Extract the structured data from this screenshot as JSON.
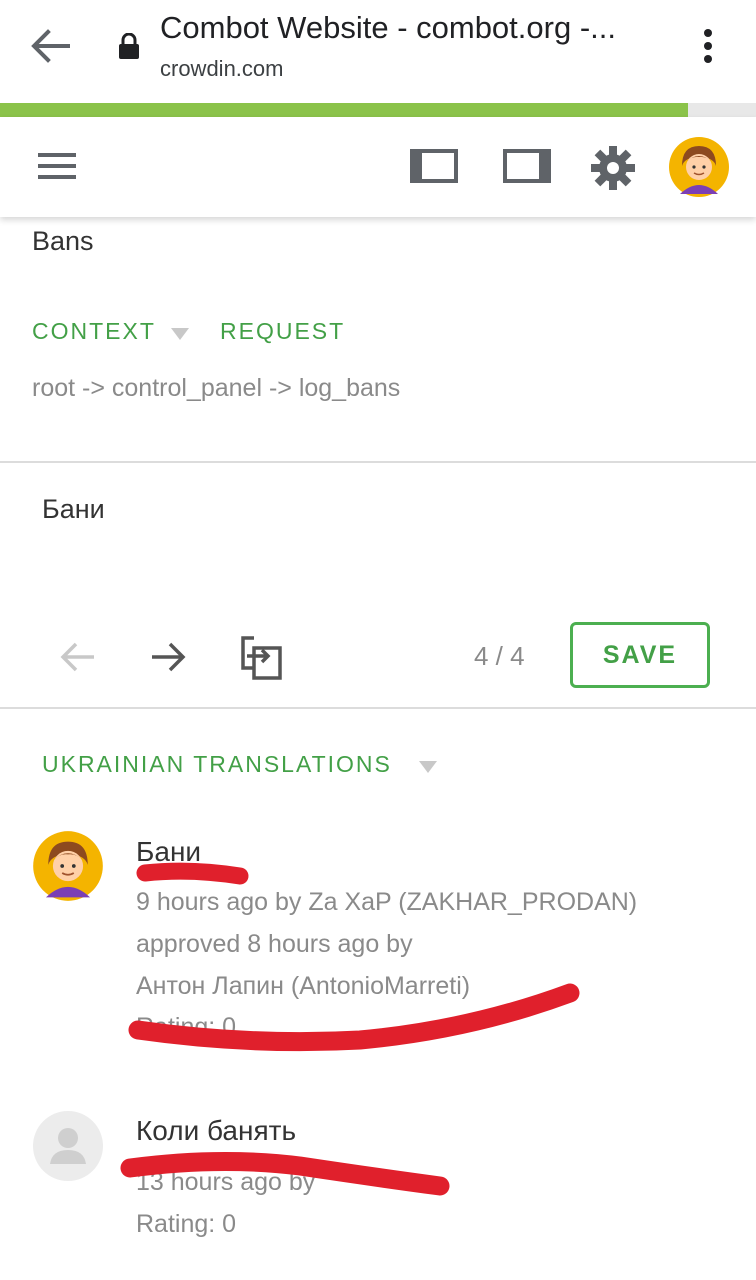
{
  "browser": {
    "title": "Combot Website - combot.org -...",
    "url": "crowdin.com",
    "load_progress": 0.91
  },
  "source": {
    "text": "Bans",
    "context_tab": "CONTEXT",
    "request_tab": "REQUEST",
    "context_path": "root -> control_panel -> log_bans"
  },
  "editor": {
    "translation": "Бани",
    "counter": "4 / 4",
    "save_label": "SAVE"
  },
  "translations": {
    "header": "UKRAINIAN TRANSLATIONS",
    "items": [
      {
        "text": "Бани",
        "meta_line1": "9 hours ago by Za XaP (ZAKHAR_PRODAN)",
        "meta_line2": "approved 8 hours ago by",
        "meta_line3": "Антон Лапин (AntonioMarreti)",
        "rating": "Rating: 0"
      },
      {
        "text": "Коли банять",
        "meta_line1": "13 hours ago by",
        "rating": "Rating: 0"
      }
    ]
  },
  "colors": {
    "accent_green": "#43a047",
    "progress_green": "#8bc34a",
    "redaction_red": "#e0202c"
  },
  "icons": [
    "back-arrow-icon",
    "lock-icon",
    "more-vert-icon",
    "hamburger-icon",
    "left-panel-icon",
    "right-panel-icon",
    "gear-icon",
    "arrow-left-icon",
    "arrow-right-icon",
    "copy-source-icon",
    "caret-down-icon",
    "person-icon"
  ]
}
